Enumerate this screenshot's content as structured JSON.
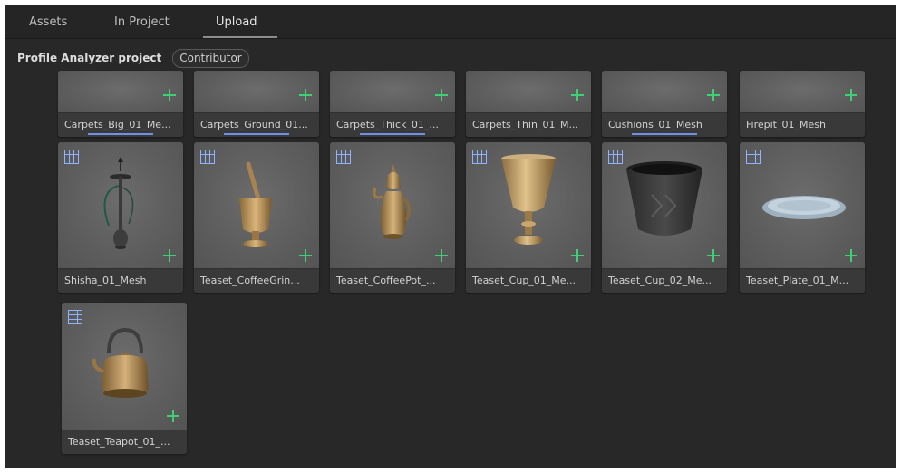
{
  "tabs": [
    {
      "label": "Assets"
    },
    {
      "label": "In Project"
    },
    {
      "label": "Upload",
      "active": true
    }
  ],
  "project": {
    "name": "Profile Analyzer project",
    "role": "Contributor"
  },
  "colors": {
    "accent_add": "#3fcf74",
    "accent_progress": "#6f8fe8",
    "mesh_icon": "#8fb4ff"
  },
  "cards": [
    {
      "label": "Carpets_Big_01_Me...",
      "progress": 1.0
    },
    {
      "label": "Carpets_Ground_01...",
      "progress": 1.0
    },
    {
      "label": "Carpets_Thick_01_...",
      "progress": 1.0
    },
    {
      "label": "Carpets_Thin_01_M...",
      "progress": 0.0
    },
    {
      "label": "Cushions_01_Mesh",
      "progress": 1.0
    },
    {
      "label": "Firepit_01_Mesh",
      "progress": 0.0
    },
    {
      "label": "Shisha_01_Mesh",
      "icon": "mesh-icon",
      "art": "shisha"
    },
    {
      "label": "Teaset_CoffeeGrin...",
      "icon": "mesh-icon",
      "art": "coffee-grinder"
    },
    {
      "label": "Teaset_CoffeePot_...",
      "icon": "mesh-icon",
      "art": "coffee-pot"
    },
    {
      "label": "Teaset_Cup_01_Me...",
      "icon": "mesh-icon",
      "art": "cup-gold"
    },
    {
      "label": "Teaset_Cup_02_Me...",
      "icon": "mesh-icon",
      "art": "cup-dark"
    },
    {
      "label": "Teaset_Plate_01_M...",
      "icon": "mesh-icon",
      "art": "plate"
    },
    {
      "label": "Teaset_Teapot_01_...",
      "icon": "mesh-icon",
      "art": "teapot"
    }
  ]
}
